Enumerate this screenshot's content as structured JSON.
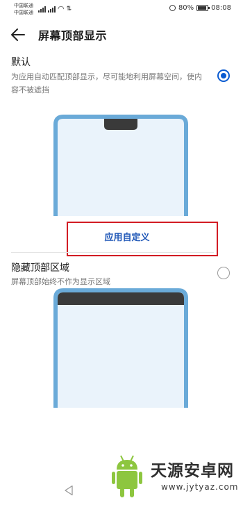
{
  "status_bar": {
    "carrier1": "中国联通",
    "carrier2": "中国联通",
    "battery": "80%",
    "time": "08:08",
    "icons": [
      "signal-icon",
      "signal-icon",
      "wifi-icon",
      "data-icon",
      "alarm-icon",
      "battery-icon"
    ]
  },
  "header": {
    "title": "屏幕顶部显示",
    "back_icon": "back-arrow-icon"
  },
  "options": [
    {
      "title": "默认",
      "description": "为应用自动匹配顶部显示，尽可能地利用屏幕空间，使内容不被遮挡",
      "selected": true
    },
    {
      "title": "隐藏顶部区域",
      "description": "屏幕顶部始终不作为显示区域",
      "selected": false
    }
  ],
  "popup": {
    "label": "应用自定义"
  },
  "colors": {
    "accent": "#0a5bd1",
    "phone_frame": "#6aaad8",
    "phone_screen": "#eaf3fb",
    "highlight_border": "#d21c24",
    "popup_text": "#1e56b7"
  },
  "watermark": {
    "name": "天源安卓网",
    "url": "www.jytyaz.com"
  }
}
